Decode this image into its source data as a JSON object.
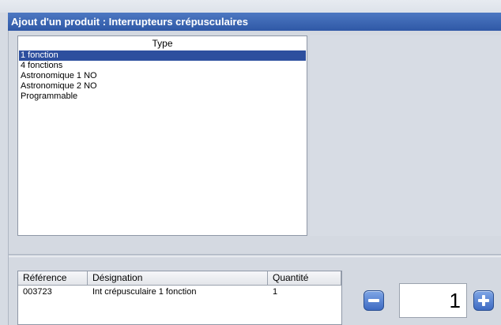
{
  "window": {
    "title": "Ajout d'un produit : Interrupteurs crépusculaires"
  },
  "type_list": {
    "header": "Type",
    "items": [
      {
        "label": "1 fonction",
        "selected": true
      },
      {
        "label": "4 fonctions",
        "selected": false
      },
      {
        "label": "Astronomique 1 NO",
        "selected": false
      },
      {
        "label": "Astronomique 2 NO",
        "selected": false
      },
      {
        "label": "Programmable",
        "selected": false
      }
    ]
  },
  "cart": {
    "columns": [
      "Référence",
      "Désignation",
      "Quantité"
    ],
    "rows": [
      {
        "reference": "003723",
        "designation": "Int crépusculaire 1 fonction",
        "quantity": "1"
      }
    ]
  },
  "quantity_stepper": {
    "value": "1",
    "minus_icon": "minus-icon",
    "plus_icon": "plus-icon"
  },
  "colors": {
    "titlebar": "#2f58a6",
    "selection": "#2d4f9e",
    "stepper_button": "#3d6ac2"
  }
}
